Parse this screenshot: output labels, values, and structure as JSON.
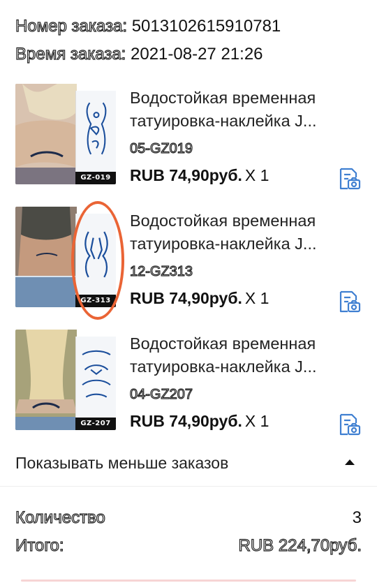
{
  "order": {
    "number_label": "Номер заказа:",
    "number_value": "5013102615910781",
    "time_label": "Время заказа:",
    "time_value": "2021-08-27 21:26"
  },
  "items": [
    {
      "title_line1": "Водостойкая временная",
      "title_line2": "татуировка-наклейка J...",
      "sku": "05-GZ019",
      "price": "RUB 74,90руб.",
      "qty": "X 1",
      "code": "GZ-019"
    },
    {
      "title_line1": "Водостойкая временная",
      "title_line2": "татуировка-наклейка J...",
      "sku": "12-GZ313",
      "price": "RUB 74,90руб.",
      "qty": "X 1",
      "code": "GZ-313"
    },
    {
      "title_line1": "Водостойкая временная",
      "title_line2": "татуировка-наклейка J...",
      "sku": "04-GZ207",
      "price": "RUB 74,90руб.",
      "qty": "X 1",
      "code": "GZ-207"
    }
  ],
  "toggle": {
    "label": "Показывать меньше заказов",
    "icon": "caret-up-icon"
  },
  "summary": {
    "quantity_label": "Количество",
    "quantity_value": "3",
    "total_label": "Итого:",
    "total_value": "RUB 224,70руб."
  },
  "colors": {
    "accent_circle": "#ea6435",
    "icon_blue": "#3f7fd1",
    "tattoo_ink": "#1c4f9c"
  }
}
